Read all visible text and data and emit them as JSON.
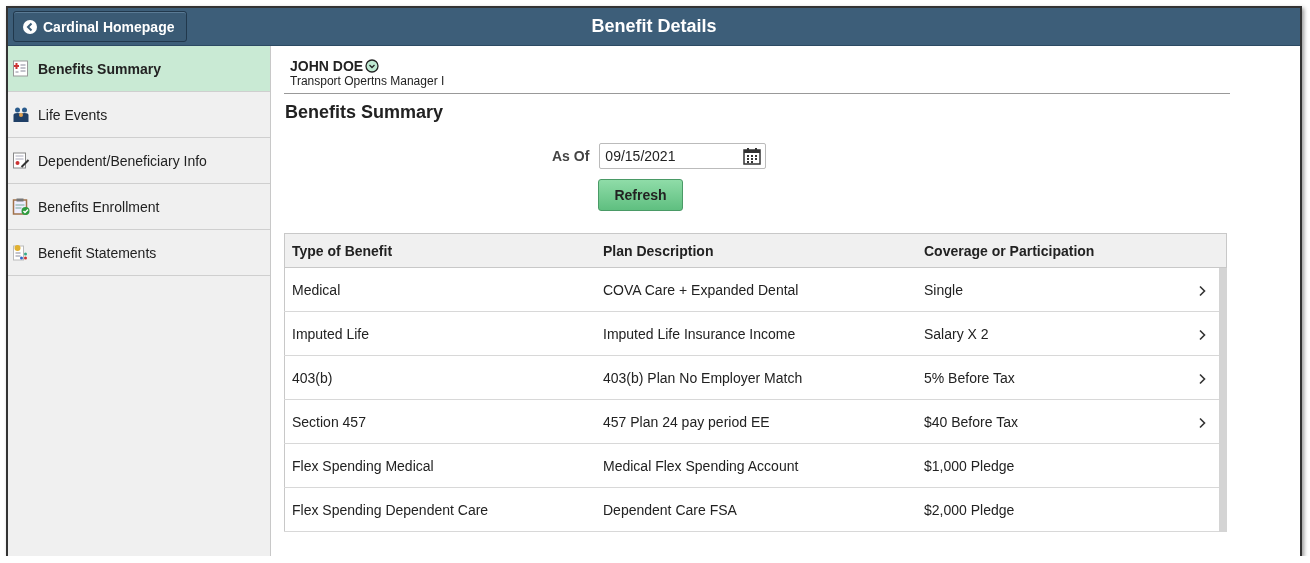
{
  "header": {
    "back_button": "Cardinal Homepage",
    "title": "Benefit Details"
  },
  "sidebar": {
    "items": [
      {
        "label": "Benefits Summary",
        "selected": true
      },
      {
        "label": "Life Events",
        "selected": false
      },
      {
        "label": "Dependent/Beneficiary Info",
        "selected": false
      },
      {
        "label": "Benefits Enrollment",
        "selected": false
      },
      {
        "label": "Benefit Statements",
        "selected": false
      }
    ]
  },
  "employee": {
    "name": "JOHN DOE",
    "job_title": "Transport Opertns Manager I"
  },
  "page_title": "Benefits Summary",
  "as_of": {
    "label": "As Of",
    "value": "09/15/2021"
  },
  "refresh_button": "Refresh",
  "table": {
    "columns": [
      "Type of Benefit",
      "Plan Description",
      "Coverage or Participation"
    ],
    "rows": [
      {
        "cells": [
          "Medical",
          "COVA Care + Expanded Dental",
          "Single"
        ],
        "has_detail": true
      },
      {
        "cells": [
          "Imputed Life",
          "Imputed Life Insurance Income",
          "Salary X 2"
        ],
        "has_detail": true
      },
      {
        "cells": [
          "403(b)",
          "403(b) Plan No Employer Match",
          "5% Before Tax"
        ],
        "has_detail": true
      },
      {
        "cells": [
          "Section 457",
          "457 Plan 24 pay period EE",
          "$40 Before Tax"
        ],
        "has_detail": true
      },
      {
        "cells": [
          "Flex Spending Medical",
          "Medical Flex Spending Account",
          "$1,000 Pledge"
        ],
        "has_detail": false
      },
      {
        "cells": [
          "Flex Spending Dependent Care",
          "Dependent Care FSA",
          "$2,000 Pledge"
        ],
        "has_detail": false
      }
    ]
  }
}
